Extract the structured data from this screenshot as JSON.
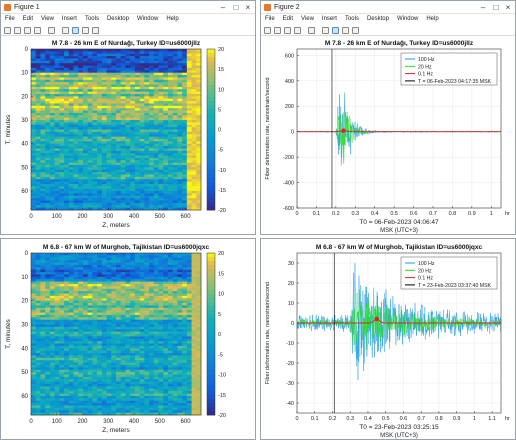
{
  "windows": [
    {
      "id": "w1",
      "title": "Figure 1",
      "menu": [
        "File",
        "Edit",
        "View",
        "Insert",
        "Tools",
        "Desktop",
        "Window",
        "Help"
      ],
      "kind": "heatmap"
    },
    {
      "id": "w2",
      "title": "Figure 2",
      "menu": [
        "File",
        "Edit",
        "View",
        "Insert",
        "Tools",
        "Desktop",
        "Window",
        "Help"
      ],
      "kind": "line"
    },
    {
      "id": "w3",
      "title": "",
      "menu": [],
      "kind": "heatmap"
    },
    {
      "id": "w4",
      "title": "",
      "menu": [],
      "kind": "line"
    }
  ],
  "colors": {
    "hz100": "#1f9be6",
    "hz20": "#22dd22",
    "hz01": "#dd2222",
    "marker": "#000000"
  },
  "chart_data": [
    {
      "type": "heatmap",
      "title": "M 7.8 - 26 km E of Nurdağı, Turkey  ID=us6000jllz",
      "xlabel": "Z, meters",
      "ylabel": "T, minutes",
      "xlim": [
        0,
        660
      ],
      "ylim": [
        0,
        68
      ],
      "xticks": [
        0,
        100,
        200,
        300,
        400,
        500,
        600
      ],
      "yticks": [
        0,
        10,
        20,
        30,
        40,
        50,
        60
      ],
      "colorbar": {
        "ticks": [
          20,
          15,
          10,
          5,
          0,
          -5,
          -10,
          -15,
          -20
        ],
        "range": [
          -20,
          20
        ]
      },
      "bands": [
        {
          "from": 0,
          "to": 10,
          "value": -16
        },
        {
          "from": 10,
          "to": 30,
          "value": 13
        },
        {
          "from": 30,
          "to": 55,
          "value": 3
        },
        {
          "from": 55,
          "to": 68,
          "value": -4
        }
      ],
      "right_strip": {
        "from_z": 610,
        "value": 18
      }
    },
    {
      "type": "line",
      "title": "M 7.8 - 26 km E of Nurdağı, Turkey  ID=us6000jllz",
      "xlabel": "T$_0$ = 06-Feb-2023 04:06:47",
      "xlabel2": "MSK (UTC+3)",
      "xunit": "hr",
      "ylabel": "Fiber deformation rate, nanostrain/second",
      "xlim": [
        0,
        1.05
      ],
      "ylim": [
        -600,
        650
      ],
      "xticks": [
        0,
        0.1,
        0.2,
        0.3,
        0.4,
        0.5,
        0.6,
        0.7,
        0.8,
        0.9,
        1
      ],
      "yticks": [
        600,
        400,
        200,
        0,
        -200,
        -400,
        -600
      ],
      "legend": {
        "position": "top-right",
        "entries": [
          "100 Hz",
          "20 Hz",
          "0.1 Hz",
          "T = 06-Feb-2023 04:17:35 MSK"
        ]
      },
      "marker_t": 0.18,
      "event": {
        "t0": 0.2,
        "peak_t": 0.23,
        "decay": 0.04,
        "amp_100": 600,
        "amp_20": 350,
        "base_100": 8,
        "base_20": 4
      },
      "slow_peak": {
        "t": 0.24,
        "value": 8
      }
    },
    {
      "type": "heatmap",
      "title": "M 6.8 - 67 km W of Murghob, Tajikistan  ID=us6000jqxc",
      "xlabel": "Z, meters",
      "ylabel": "T, minutes",
      "xlim": [
        0,
        660
      ],
      "ylim": [
        0,
        68
      ],
      "xticks": [
        0,
        100,
        200,
        300,
        400,
        500,
        600
      ],
      "yticks": [
        0,
        10,
        20,
        30,
        40,
        50,
        60
      ],
      "colorbar": {
        "ticks": [
          20,
          15,
          10,
          5,
          0,
          -5,
          -10,
          -15,
          -20
        ],
        "range": [
          -20,
          20
        ]
      },
      "bands": [
        {
          "from": 0,
          "to": 12,
          "value": -8
        },
        {
          "from": 12,
          "to": 28,
          "value": 10
        },
        {
          "from": 28,
          "to": 68,
          "value": 1
        }
      ],
      "right_strip": {
        "from_z": 620,
        "value": 15
      }
    },
    {
      "type": "line",
      "title": "M 6.8 - 67 km W of Murghob, Tajikistan  ID=us6000jqxc",
      "xlabel": "T$_0$ = 23-Feb-2023 03:25:15",
      "xlabel2": "MSK (UTC+3)",
      "xunit": "hr",
      "ylabel": "Fiber deformation rate, nanostrain/second",
      "xlim": [
        0,
        1.15
      ],
      "ylim": [
        -45,
        35
      ],
      "xticks": [
        0,
        0.1,
        0.2,
        0.3,
        0.4,
        0.5,
        0.6,
        0.7,
        0.8,
        0.9,
        1,
        1.1
      ],
      "yticks": [
        30,
        20,
        10,
        0,
        -10,
        -20,
        -30,
        -40
      ],
      "legend": {
        "position": "top-right",
        "entries": [
          "100 Hz",
          "20 Hz",
          "0.1 Hz",
          "T = 23-Feb-2023 03:37:40 MSK"
        ]
      },
      "marker_t": 0.21,
      "event": {
        "t0": 0.3,
        "peak_t": 0.32,
        "decay": 0.2,
        "amp_100": 35,
        "amp_20": 20,
        "base_100": 5,
        "base_20": 2
      },
      "slow_peak": {
        "t": 0.45,
        "value": 2
      }
    }
  ]
}
